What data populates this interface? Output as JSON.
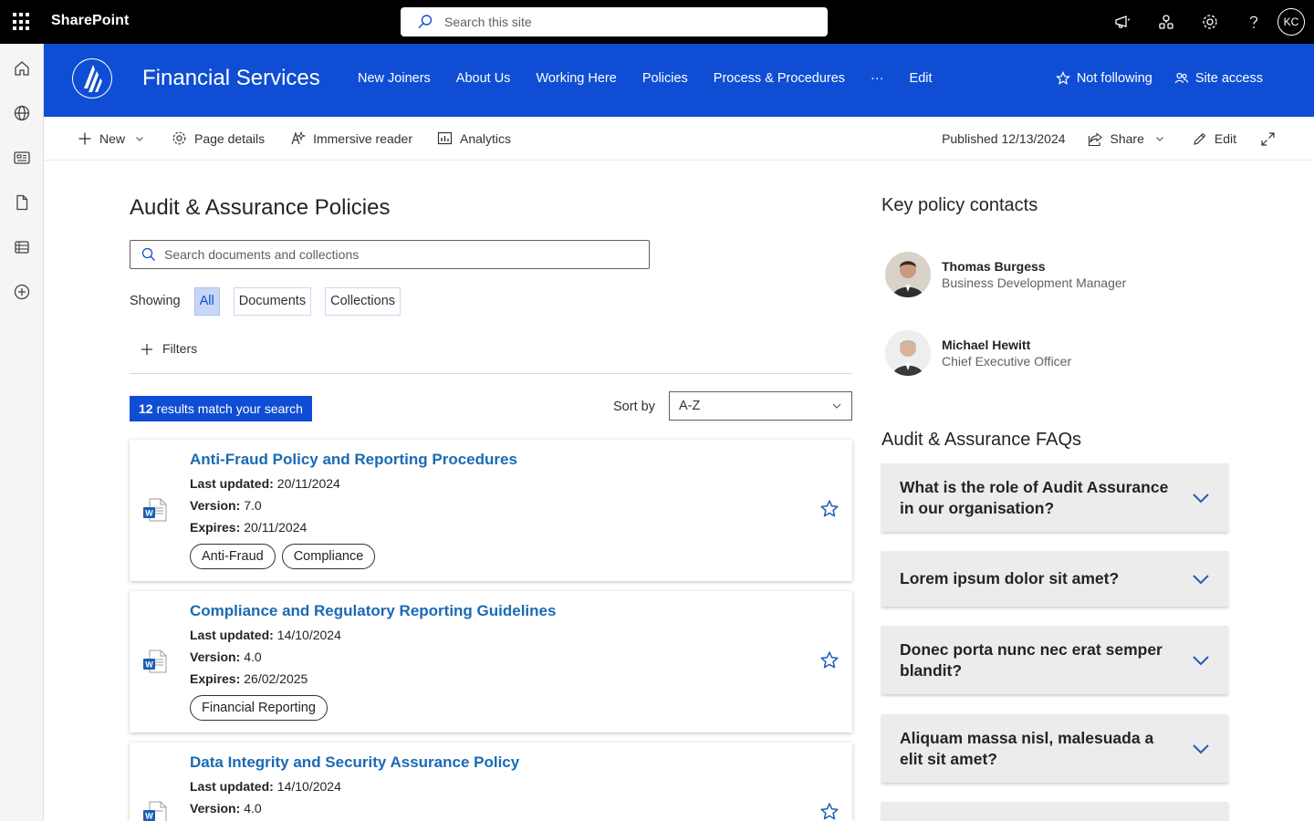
{
  "suite": {
    "brand": "SharePoint",
    "search_placeholder": "Search this site",
    "user_initials": "KC"
  },
  "site": {
    "title": "Financial Services",
    "nav": [
      "New Joiners",
      "About Us",
      "Working Here",
      "Policies",
      "Process & Procedures",
      "···",
      "Edit"
    ],
    "follow_label": "Not following",
    "access_label": "Site access"
  },
  "commandbar": {
    "new_label": "New",
    "page_details_label": "Page details",
    "immersive_label": "Immersive reader",
    "analytics_label": "Analytics",
    "published": "Published 12/13/2024",
    "share_label": "Share",
    "edit_label": "Edit"
  },
  "main": {
    "title": "Audit & Assurance Policies",
    "search_placeholder": "Search documents and collections",
    "showing_label": "Showing",
    "filters_tabs": [
      "All",
      "Documents",
      "Collections"
    ],
    "filters_label": "Filters",
    "results_count": "12",
    "results_text": "results match your search",
    "sort_label": "Sort by",
    "sort_value": "A-Z",
    "meta_labels": {
      "updated": "Last updated:",
      "version": "Version:",
      "expires": "Expires:"
    },
    "documents": [
      {
        "title": "Anti-Fraud Policy and Reporting Procedures",
        "updated": "20/11/2024",
        "version": "7.0",
        "expires": "20/11/2024",
        "tags": [
          "Anti-Fraud",
          "Compliance"
        ]
      },
      {
        "title": "Compliance and Regulatory Reporting Guidelines",
        "updated": "14/10/2024",
        "version": "4.0",
        "expires": "26/02/2025",
        "tags": [
          "Financial Reporting"
        ]
      },
      {
        "title": "Data Integrity and Security Assurance Policy",
        "updated": "14/10/2024",
        "version": "4.0"
      }
    ]
  },
  "contacts": {
    "title": "Key policy contacts",
    "people": [
      {
        "name": "Thomas Burgess",
        "role": "Business Development Manager"
      },
      {
        "name": "Michael Hewitt",
        "role": "Chief Executive Officer"
      }
    ]
  },
  "faqs": {
    "title": "Audit & Assurance FAQs",
    "items": [
      "What is the role of Audit Assurance in our organisation?",
      "Lorem ipsum dolor sit amet?",
      "Donec porta nunc nec erat semper blandit?",
      "Aliquam massa nisl, malesuada a elit sit amet?"
    ]
  },
  "colors": {
    "suite_bar": "#000000",
    "site_header": "#0f4ed4",
    "link": "#1a6ab5",
    "faq_bg": "#ececec"
  }
}
